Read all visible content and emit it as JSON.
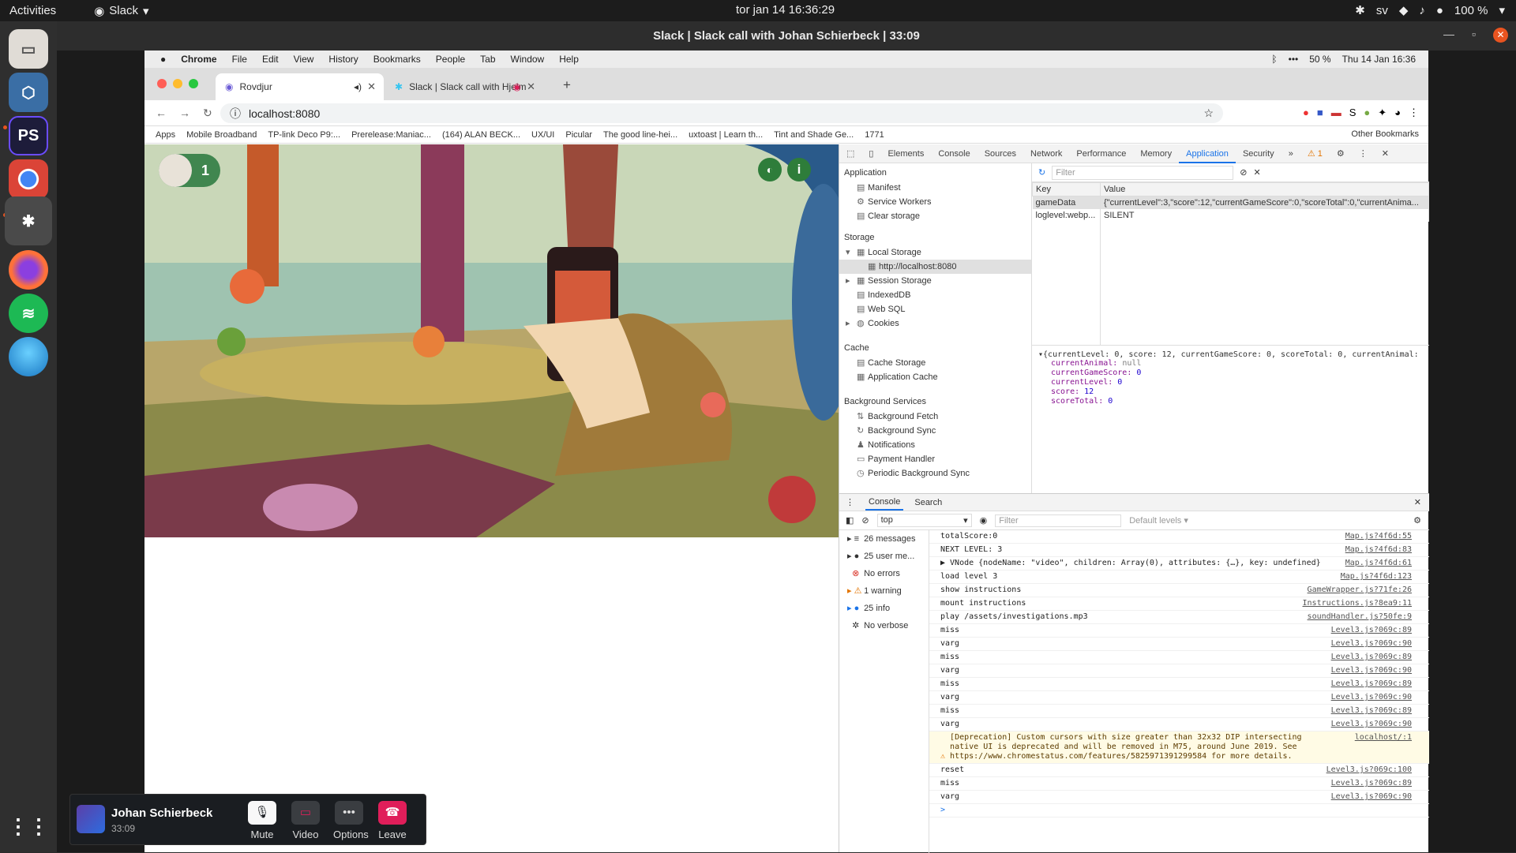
{
  "topbar": {
    "activities": "Activities",
    "app": "Slack",
    "clock": "tor jan 14  16:36:29",
    "lang": "sv",
    "battery": "100 %"
  },
  "window": {
    "title": "Slack | Slack call with Johan Schierbeck | 33:09"
  },
  "mac_menu": {
    "items": [
      "Chrome",
      "File",
      "Edit",
      "View",
      "History",
      "Bookmarks",
      "People",
      "Tab",
      "Window",
      "Help"
    ],
    "battery": "50 %",
    "datetime": "Thu 14 Jan  16:36"
  },
  "tabs": [
    {
      "label": "Rovdjur"
    },
    {
      "label": "Slack | Slack call with Hjelm"
    }
  ],
  "address": {
    "url": "localhost:8080"
  },
  "bookmarks": {
    "items": [
      "Apps",
      "Mobile Broadband",
      "TP-link Deco P9:...",
      "Prerelease:Maniac...",
      "(164) ALAN BECK...",
      "UX/UI",
      "Picular",
      "The good line-hei...",
      "uxtoast | Learn th...",
      "Tint and Shade Ge...",
      "1771"
    ],
    "other": "Other Bookmarks"
  },
  "game": {
    "level": "1"
  },
  "devtools": {
    "tabs": [
      "Elements",
      "Console",
      "Sources",
      "Network",
      "Performance",
      "Memory",
      "Application",
      "Security"
    ],
    "warnings": "1",
    "sidebar": {
      "application_title": "Application",
      "application": [
        "Manifest",
        "Service Workers",
        "Clear storage"
      ],
      "storage_title": "Storage",
      "storage": [
        "Local Storage",
        "http://localhost:8080",
        "Session Storage",
        "IndexedDB",
        "Web SQL",
        "Cookies"
      ],
      "cache_title": "Cache",
      "cache": [
        "Cache Storage",
        "Application Cache"
      ],
      "bg_title": "Background Services",
      "bg": [
        "Background Fetch",
        "Background Sync",
        "Notifications",
        "Payment Handler",
        "Periodic Background Sync"
      ]
    },
    "filter_placeholder": "Filter",
    "table": {
      "headers": [
        "Key",
        "Value"
      ],
      "rows": [
        [
          "gameData",
          "{\"currentLevel\":3,\"score\":12,\"currentGameScore\":0,\"scoreTotal\":0,\"currentAnima..."
        ],
        [
          "loglevel:webp...",
          "SILENT"
        ]
      ]
    },
    "preview": {
      "summary": "{currentLevel: 0, score: 12, currentGameScore: 0, scoreTotal: 0, currentAnimal: n",
      "props": [
        [
          "currentAnimal",
          "null"
        ],
        [
          "currentGameScore",
          "0"
        ],
        [
          "currentLevel",
          "0"
        ],
        [
          "score",
          "12"
        ],
        [
          "scoreTotal",
          "0"
        ]
      ]
    },
    "drawer": {
      "tabs": [
        "Console",
        "Search"
      ],
      "context": "top",
      "filter": "Filter",
      "levels": "Default levels ▾"
    },
    "console_side": [
      "26 messages",
      "25 user me...",
      "No errors",
      "1 warning",
      "25 info",
      "No verbose"
    ],
    "logs": [
      {
        "t": "totalScore:0",
        "s": "Map.js?4f6d:55"
      },
      {
        "t": "NEXT LEVEL: 3",
        "s": "Map.js?4f6d:83"
      },
      {
        "t": "▶ VNode {nodeName: \"video\", children: Array(0), attributes: {…}, key: undefined}",
        "s": "Map.js?4f6d:61"
      },
      {
        "t": "load level 3",
        "s": "Map.js?4f6d:123"
      },
      {
        "t": "show instructions",
        "s": "GameWrapper.js?71fe:26"
      },
      {
        "t": "mount instructions",
        "s": "Instructions.js?8ea9:11"
      },
      {
        "t": "play /assets/investigations.mp3",
        "s": "soundHandler.js?50fe:9"
      },
      {
        "t": "miss",
        "s": "Level3.js?069c:89"
      },
      {
        "t": "varg",
        "s": "Level3.js?069c:90"
      },
      {
        "t": "miss",
        "s": "Level3.js?069c:89"
      },
      {
        "t": "varg",
        "s": "Level3.js?069c:90"
      },
      {
        "t": "miss",
        "s": "Level3.js?069c:89"
      },
      {
        "t": "varg",
        "s": "Level3.js?069c:90"
      },
      {
        "t": "miss",
        "s": "Level3.js?069c:89"
      },
      {
        "t": "varg",
        "s": "Level3.js?069c:90"
      }
    ],
    "warning": {
      "t": "[Deprecation] Custom cursors with size greater than 32x32 DIP intersecting native UI is deprecated and will be removed in M75, around June 2019. See https://www.chromestatus.com/features/5825971391299584 for more details.",
      "s": "localhost/:1"
    },
    "logs2": [
      {
        "t": "reset",
        "s": "Level3.js?069c:100"
      },
      {
        "t": "miss",
        "s": "Level3.js?069c:89"
      },
      {
        "t": "varg",
        "s": "Level3.js?069c:90"
      }
    ],
    "prompt": ">"
  },
  "call": {
    "name": "Johan Schierbeck",
    "time": "33:09",
    "buttons": [
      "Mute",
      "Video",
      "Options",
      "Leave"
    ]
  }
}
